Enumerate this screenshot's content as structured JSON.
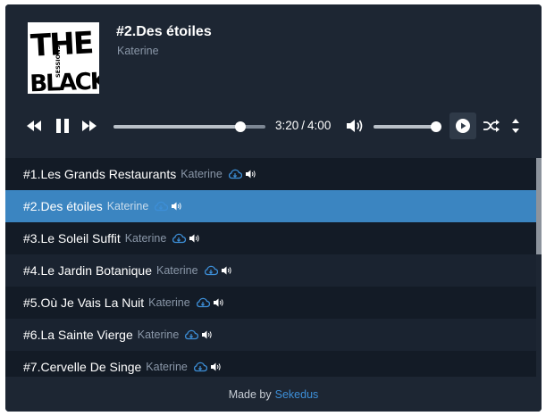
{
  "now_playing": {
    "title": "#2.Des étoiles",
    "artist": "Katerine",
    "cover_text_big": "THE BLACK",
    "cover_text_small": "SESSIONS"
  },
  "player": {
    "current_time": "3:20",
    "separator": "/",
    "duration": "4:00",
    "progress_fraction": 0.8333,
    "volume_fraction": 1.0,
    "is_playing": true
  },
  "playlist": [
    {
      "title": "#1.Les Grands Restaurants",
      "artist": "Katerine",
      "active": false
    },
    {
      "title": "#2.Des étoiles",
      "artist": "Katerine",
      "active": true
    },
    {
      "title": "#3.Le Soleil Suffit",
      "artist": "Katerine",
      "active": false
    },
    {
      "title": "#4.Le Jardin Botanique",
      "artist": "Katerine",
      "active": false
    },
    {
      "title": "#5.Où Je Vais La Nuit",
      "artist": "Katerine",
      "active": false
    },
    {
      "title": "#6.La Sainte Vierge",
      "artist": "Katerine",
      "active": false
    },
    {
      "title": "#7.Cervelle De Singe",
      "artist": "Katerine",
      "active": false
    }
  ],
  "footer": {
    "made_by": "Made by",
    "author": "Sekedus"
  },
  "colors": {
    "background": "#1d2633",
    "active_row": "#3b85c1",
    "accent_link": "#3d8fd8",
    "download_icon": "#3d8fd8"
  },
  "icons": {
    "prev": "rewind-icon",
    "pause": "pause-icon",
    "next": "fast-forward-icon",
    "volume": "volume-icon",
    "autoplay": "play-circle-icon",
    "shuffle": "shuffle-icon",
    "sort": "sort-icon",
    "download": "cloud-download-icon",
    "sound": "speaker-icon"
  }
}
